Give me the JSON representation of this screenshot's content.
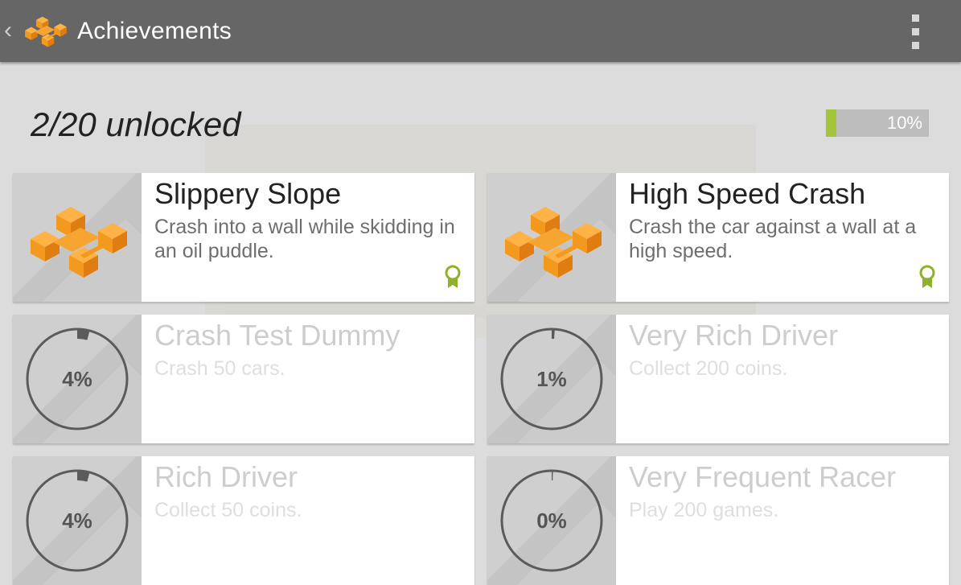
{
  "appbar": {
    "title": "Achievements"
  },
  "summary": {
    "unlocked_text": "2/20 unlocked",
    "progress_label": "10%",
    "progress_value": 0.1
  },
  "colors": {
    "accent": "#a4c439",
    "appbar": "#666666",
    "logo": "#f39a1e"
  },
  "achievements": [
    {
      "name": "Slippery Slope",
      "description": "Crash into a wall while skidding in an oil puddle.",
      "unlocked": true
    },
    {
      "name": "High Speed Crash",
      "description": "Crash the car against a wall at a high speed.",
      "unlocked": true
    },
    {
      "name": "Crash Test Dummy",
      "description": "Crash 50 cars.",
      "unlocked": false,
      "progress_label": "4%",
      "progress_value": 0.04
    },
    {
      "name": "Very Rich Driver",
      "description": "Collect 200 coins.",
      "unlocked": false,
      "progress_label": "1%",
      "progress_value": 0.01
    },
    {
      "name": "Rich Driver",
      "description": "Collect 50 coins.",
      "unlocked": false,
      "progress_label": "4%",
      "progress_value": 0.04
    },
    {
      "name": "Very Frequent Racer",
      "description": "Play 200 games.",
      "unlocked": false,
      "progress_label": "0%",
      "progress_value": 0.0
    }
  ]
}
